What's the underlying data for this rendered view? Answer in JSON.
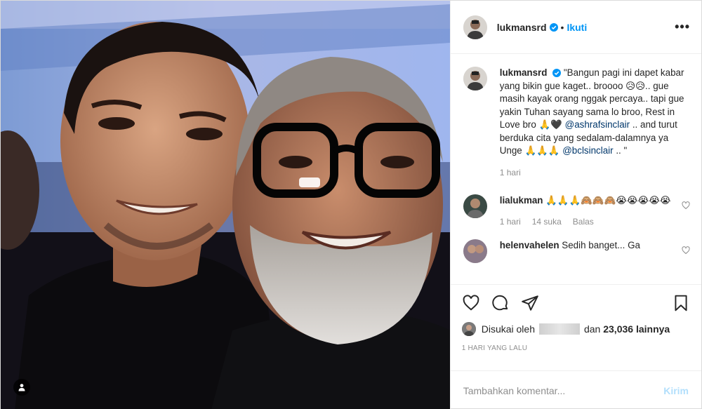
{
  "post": {
    "username": "lukmansrd",
    "follow_label": "Ikuti",
    "separator": "•",
    "more_label": "•••"
  },
  "caption": {
    "username": "lukmansrd",
    "text_1": "\"Bangun pagi ini dapet kabar yang bikin gue kaget.. broooo 😥😥.. gue masih kayak orang nggak percaya.. tapi gue yakin Tuhan sayang sama lo broo, Rest in Love bro 🙏🖤 ",
    "mention_1": "@ashrafsinclair",
    "text_2": " .. and turut berduka cita yang sedalam-dalamnya ya Unge 🙏🙏🙏 ",
    "mention_2": "@bclsinclair",
    "text_3": " .. \"",
    "time": "1 hari"
  },
  "comments": [
    {
      "username": "lialukman",
      "text": " 🙏🙏🙏🙈🙈🙈😭😭😭😭😭",
      "time": "1 hari",
      "likes": "14 suka",
      "reply": "Balas"
    },
    {
      "username": "helenvahelen",
      "text": " Sedih banget... Ga"
    }
  ],
  "likes": {
    "prefix": "Disukai oleh",
    "conjunction": "dan",
    "count": "23,036",
    "suffix": "lainnya"
  },
  "timestamp": "1 HARI YANG LALU",
  "add_comment": {
    "placeholder": "Tambahkan komentar...",
    "post_label": "Kirim"
  },
  "colors": {
    "accent": "#0095f6",
    "link": "#00376b",
    "muted": "#8e8e8e",
    "post_disabled": "#b2dffc"
  }
}
